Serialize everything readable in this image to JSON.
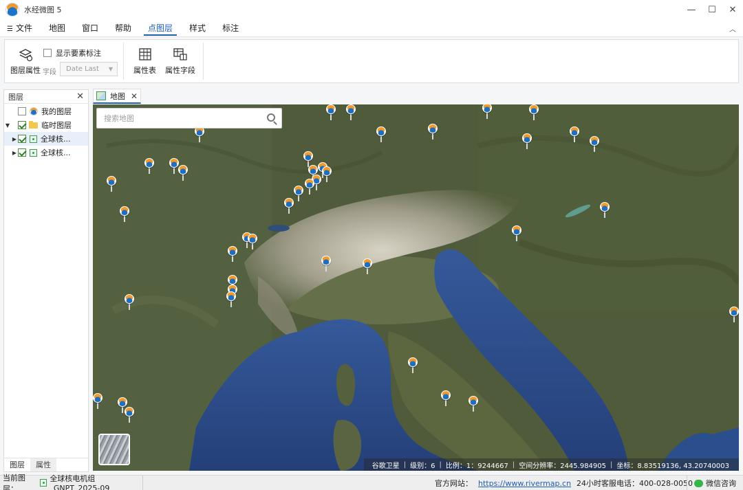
{
  "window": {
    "title": "水经微图 5",
    "controls": {
      "minimize": "—",
      "maximize": "☐",
      "close": "✕"
    }
  },
  "menu": {
    "hamburger": "☰",
    "items": [
      "文件",
      "地图",
      "窗口",
      "帮助",
      "点图层",
      "样式",
      "标注"
    ],
    "active": "点图层",
    "collapse": "︿"
  },
  "ribbon": {
    "layer_props_label": "图层属性",
    "show_labels_checkbox": "显示要素标注",
    "show_labels_checked": false,
    "field_label": "字段",
    "field_select_value": "Date Last",
    "attr_table_label": "属性表",
    "attr_fields_label": "属性字段"
  },
  "layer_panel": {
    "title": "图层",
    "close": "✕",
    "tree": [
      {
        "label": "我的图层",
        "checked": false,
        "icon": "globe-logo-icon"
      },
      {
        "label": "临时图层",
        "checked": true,
        "icon": "folder-icon",
        "expanded": true
      },
      {
        "label": "全球核...",
        "checked": true,
        "icon": "point-layer-icon",
        "selected": true
      },
      {
        "label": "全球核...",
        "checked": true,
        "icon": "point-layer-icon",
        "selected": false
      }
    ],
    "tabs": [
      "图层",
      "属性"
    ]
  },
  "doc_tab": {
    "label": "地图",
    "close": "✕"
  },
  "map": {
    "search_placeholder": "搜索地图",
    "status": {
      "source": "谷歌卫星",
      "level_label": "级别：",
      "level": "6",
      "scale_label": "比例：",
      "scale": "1：9244667",
      "resolution_label": "空间分辨率：",
      "resolution": "2445.984905",
      "coord_label": "坐标：",
      "coord": "8.83519136, 43.20740003"
    },
    "colors": {
      "pin_orange": "#f29b2a",
      "pin_blue": "#1e6fc2",
      "sea": "#2b4f8c",
      "land": "#4e5a3c",
      "alps": "#d8d4c8"
    }
  },
  "statusbar": {
    "current_layer_label": "当前图层：",
    "current_layer": "全球核电机组_GNPT_2025-09",
    "website_label": "官方网站：",
    "website": "https://www.rivermap.cn",
    "hotline_label": "24小时客服电话：",
    "hotline": "400-028-0050",
    "wechat": "微信咨询"
  }
}
